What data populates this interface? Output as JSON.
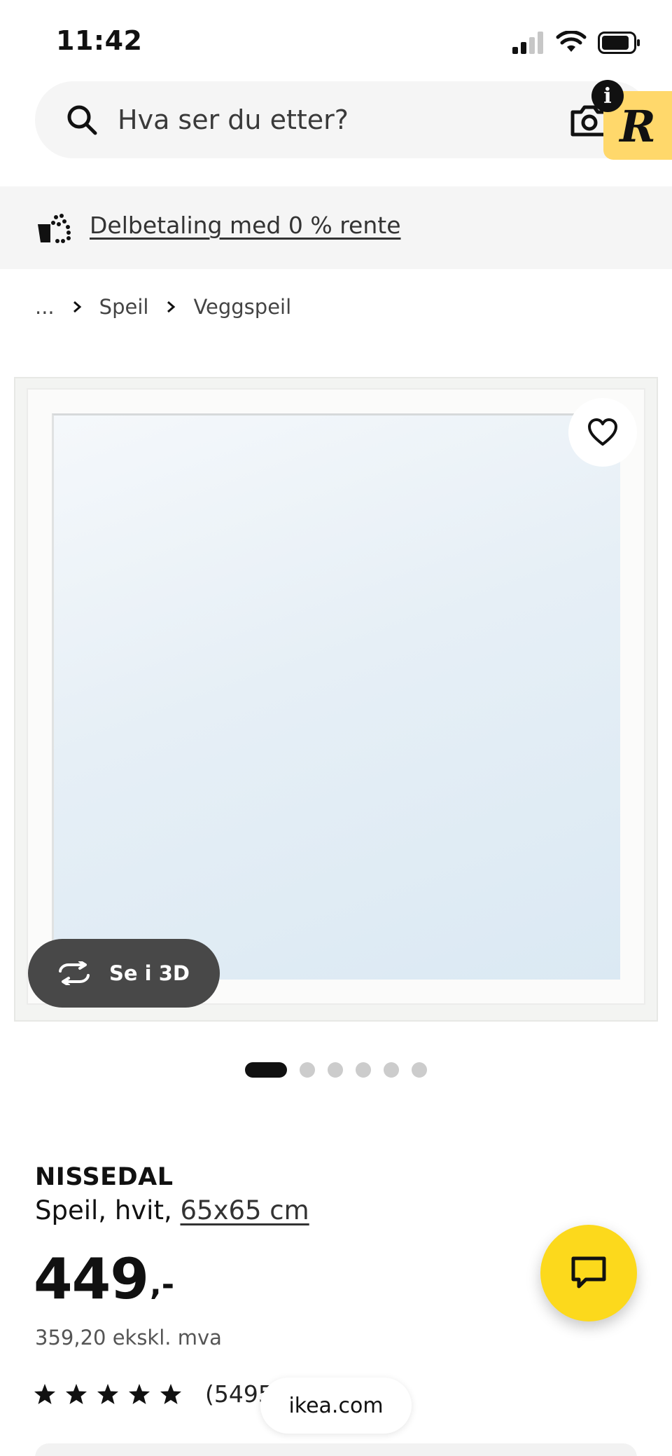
{
  "status_bar": {
    "time": "11:42"
  },
  "search": {
    "placeholder": "Hva ser du etter?"
  },
  "extension": {
    "letter": "R",
    "info": "i"
  },
  "promo": {
    "text": "Delbetaling med 0 % rente"
  },
  "breadcrumb": {
    "items": [
      "...",
      "Speil",
      "Veggspeil"
    ]
  },
  "carousel": {
    "count": 6,
    "active_index": 0
  },
  "view_3d": {
    "label": "Se i 3D"
  },
  "product": {
    "name": "NISSEDAL",
    "description": "Speil, hvit,",
    "size": "65x65 cm",
    "price_main": "449",
    "price_suffix": ",-",
    "price_ex_vat": "359,20 ekskl. mva",
    "rating_stars": 5,
    "rating_count": "(5495)"
  },
  "browser": {
    "url": "ikea.com"
  },
  "colors": {
    "accent_yellow": "#fcd91c",
    "extension_yellow": "#ffd86b",
    "text": "#111111"
  }
}
